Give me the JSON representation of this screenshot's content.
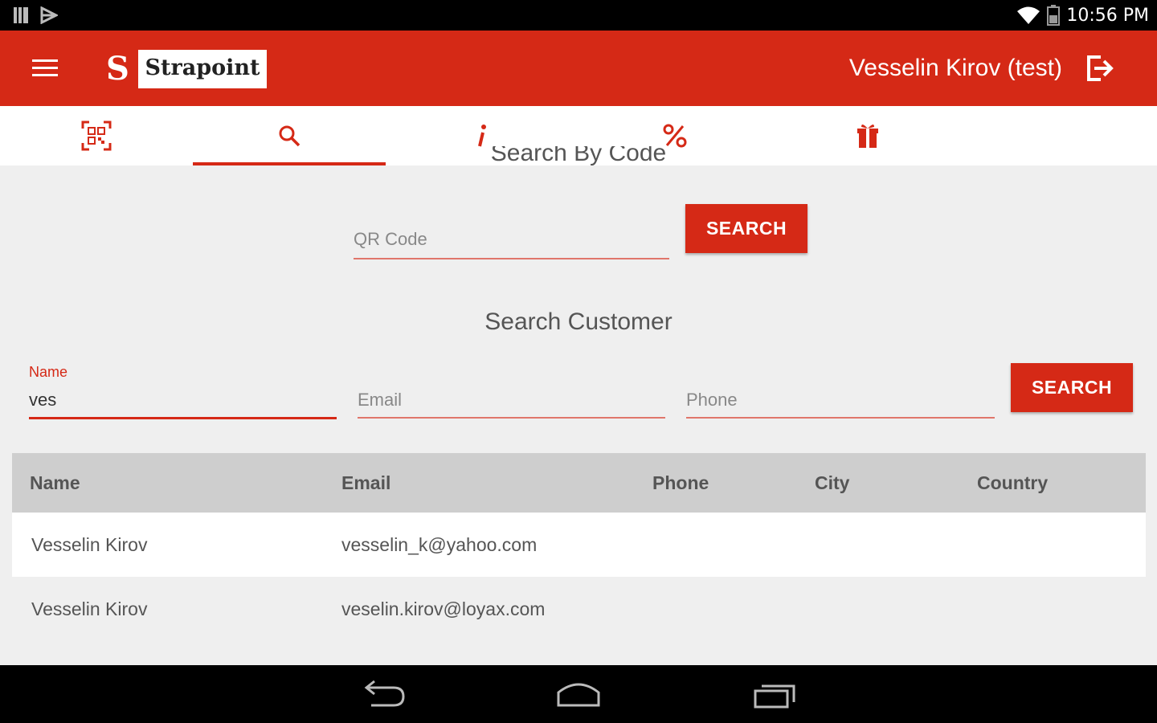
{
  "status_bar": {
    "time": "10:56 PM"
  },
  "app_bar": {
    "logo_letter": "S",
    "brand_name": "Strapoint",
    "user_name": "Vesselin Kirov (test)"
  },
  "tabs": [
    {
      "icon": "qr-scan-icon"
    },
    {
      "icon": "search-icon",
      "active": true
    },
    {
      "icon": "info-icon"
    },
    {
      "icon": "percent-icon"
    },
    {
      "icon": "gift-icon"
    }
  ],
  "search_by_code": {
    "title": "Search By Code",
    "qr_placeholder": "QR Code",
    "button_label": "SEARCH"
  },
  "search_customer": {
    "title": "Search Customer",
    "name_label": "Name",
    "name_value": "ves",
    "email_placeholder": "Email",
    "phone_placeholder": "Phone",
    "button_label": "SEARCH"
  },
  "results": {
    "columns": [
      "Name",
      "Email",
      "Phone",
      "City",
      "Country"
    ],
    "rows": [
      {
        "name": "Vesselin Kirov",
        "email": "vesselin_k@yahoo.com",
        "phone": "",
        "city": "",
        "country": ""
      },
      {
        "name": "Vesselin Kirov",
        "email": "veselin.kirov@loyax.com",
        "phone": "",
        "city": "",
        "country": ""
      }
    ]
  },
  "colors": {
    "accent": "#d52916",
    "header_row": "#cecece",
    "background": "#efefef"
  }
}
